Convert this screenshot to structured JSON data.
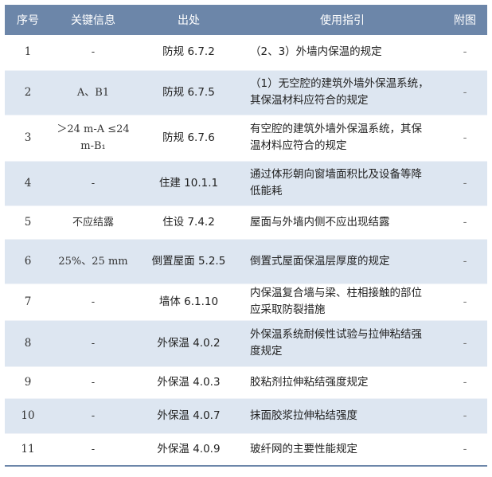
{
  "header": {
    "index": "序号",
    "key_info": "关键信息",
    "source": "出处",
    "usage": "使用指引",
    "figure": "附图"
  },
  "rows": [
    {
      "index": "1",
      "key": "-",
      "source": "防规 6.7.2",
      "usage": "（2、3）外墙内保温的规定",
      "figure": "-"
    },
    {
      "index": "2",
      "key": "A、B1",
      "source": "防规 6.7.5",
      "usage": "（1）无空腔的建筑外墙外保温系统，其保温材料应符合的规定",
      "figure": "-"
    },
    {
      "index": "3",
      "key": "＞24 m-A ≤24 m-B₁",
      "source": "防规 6.7.6",
      "usage": "有空腔的建筑外墙外保温系统，其保温材料应符合的规定",
      "figure": "-"
    },
    {
      "index": "4",
      "key": "-",
      "source": "住建 10.1.1",
      "usage": "通过体形朝向窗墙面积比及设备等降低能耗",
      "figure": "-"
    },
    {
      "index": "5",
      "key": "不应结露",
      "source": "住设 7.4.2",
      "usage": "屋面与外墙内侧不应出现结露",
      "figure": "-"
    },
    {
      "index": "6",
      "key": "25%、25 mm",
      "source": "倒置屋面 5.2.5",
      "usage": "倒置式屋面保温层厚度的规定",
      "figure": "-"
    },
    {
      "index": "7",
      "key": "-",
      "source": "墙体 6.1.10",
      "usage": "内保温复合墙与梁、柱相接触的部位应采取防裂措施",
      "figure": "-"
    },
    {
      "index": "8",
      "key": "-",
      "source": "外保温 4.0.2",
      "usage": "外保温系统耐候性试验与拉伸粘结强度规定",
      "figure": "-"
    },
    {
      "index": "9",
      "key": "-",
      "source": "外保温 4.0.3",
      "usage": "胶粘剂拉伸粘结强度规定",
      "figure": "-"
    },
    {
      "index": "10",
      "key": "-",
      "source": "外保温 4.0.7",
      "usage": "抹面胶浆拉伸粘结强度",
      "figure": "-"
    },
    {
      "index": "11",
      "key": "-",
      "source": "外保温 4.0.9",
      "usage": "玻纤网的主要性能规定",
      "figure": "-"
    }
  ]
}
